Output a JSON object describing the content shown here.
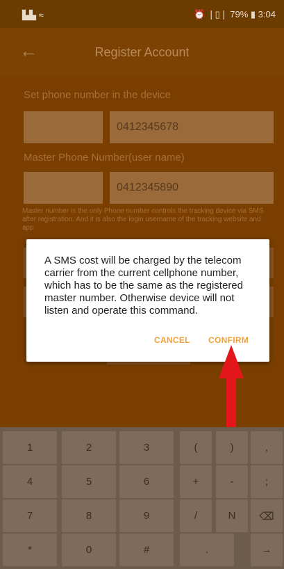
{
  "status_bar": {
    "signal_icons": "▙▙ ≈",
    "right_text": "⏰ ❘▯❘ 79% ▮ 3:04"
  },
  "header": {
    "title": "Register Account"
  },
  "form": {
    "device_label": "Set phone number in the device",
    "device_number": "0412345678",
    "master_label": "Master Phone Number(user name)",
    "master_number": "0412345890",
    "hint": "Master number is the only Phone number controls the tracking device via SMS after registration. And it is also the login username of the tracking website and app"
  },
  "dialog": {
    "message": "A SMS cost will be charged by the telecom carrier from the current cellphone number, which has to be the same as the registered master number. Otherwise device will not listen and operate this command.",
    "cancel_label": "CANCEL",
    "confirm_label": "CONFIRM"
  },
  "keyboard": {
    "row1": [
      "1",
      "2",
      "3",
      "(",
      ")",
      ","
    ],
    "row2": [
      "4",
      "5",
      "6",
      "+",
      "-",
      ";"
    ],
    "row3": [
      "7",
      "8",
      "9",
      "/",
      "N",
      "⌫"
    ],
    "row4": [
      "*",
      "0",
      "#",
      ".",
      "→"
    ]
  },
  "colors": {
    "overlay": "#7a3f00",
    "accent": "#f0a13a",
    "arrow": "#e3161b"
  }
}
